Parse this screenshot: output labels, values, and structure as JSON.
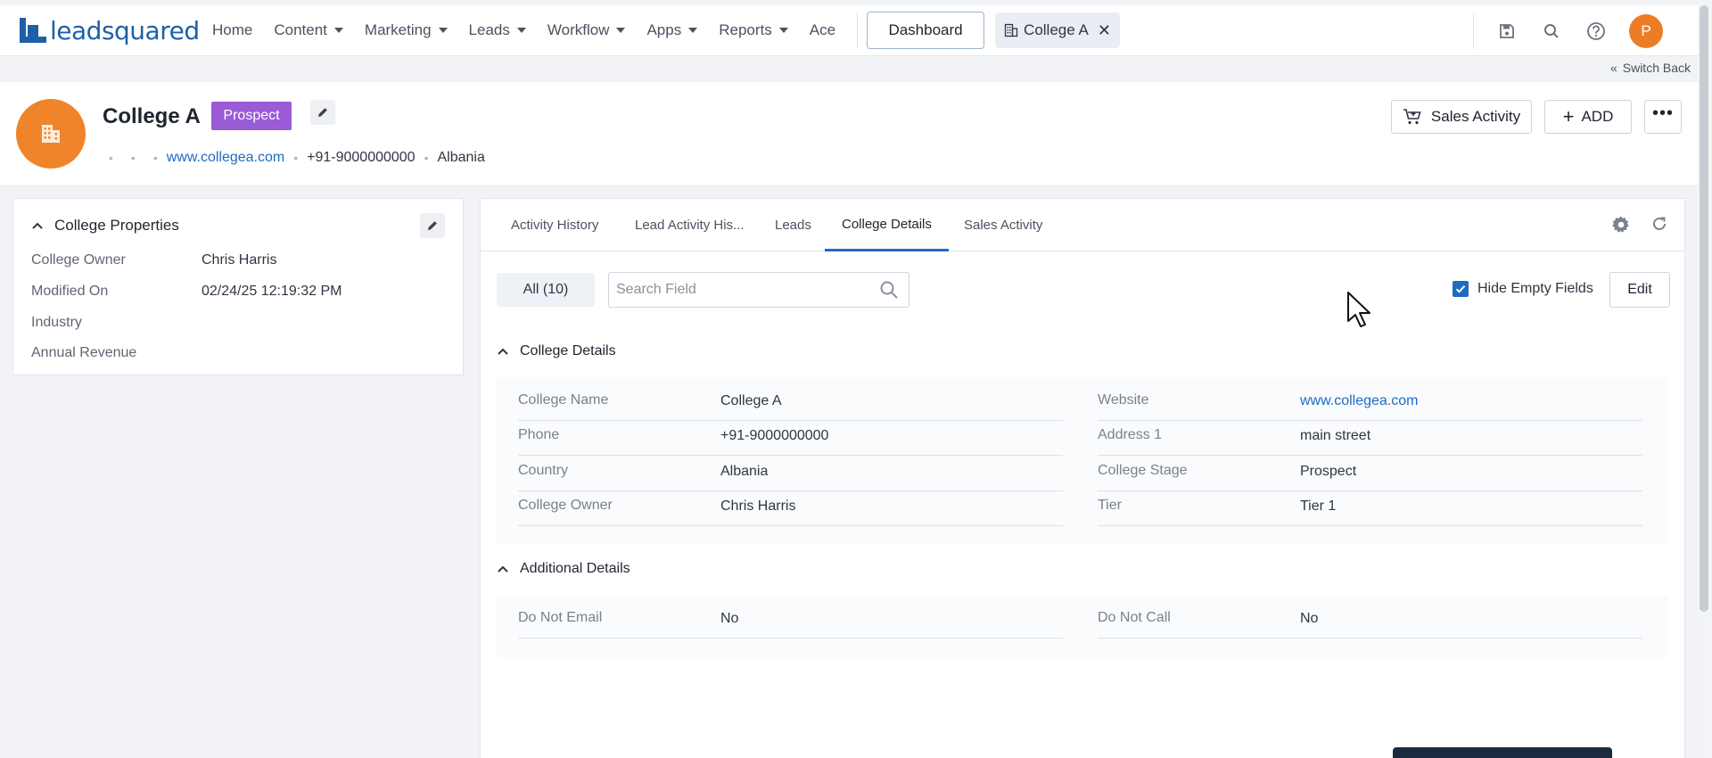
{
  "nav": {
    "logo_text": "leadsquared",
    "items": [
      {
        "label": "Home",
        "caret": false
      },
      {
        "label": "Content",
        "caret": true
      },
      {
        "label": "Marketing",
        "caret": true
      },
      {
        "label": "Leads",
        "caret": true
      },
      {
        "label": "Workflow",
        "caret": true
      },
      {
        "label": "Apps",
        "caret": true
      },
      {
        "label": "Reports",
        "caret": true
      },
      {
        "label": "Ace",
        "caret": false
      }
    ],
    "dashboard_label": "Dashboard",
    "open_tab_label": "College A",
    "avatar_initial": "P"
  },
  "switch_back": "Switch Back",
  "header": {
    "name": "College A",
    "stage_badge": "Prospect",
    "website": "www.collegea.com",
    "phone": "+91-9000000000",
    "country": "Albania",
    "sales_activity_label": "Sales Activity",
    "add_label": "ADD"
  },
  "properties": {
    "title": "College Properties",
    "rows": [
      {
        "key": "College Owner",
        "value": "Chris Harris"
      },
      {
        "key": "Modified On",
        "value": "02/24/25 12:19:32 PM"
      },
      {
        "key": "Industry",
        "value": ""
      },
      {
        "key": "Annual Revenue",
        "value": ""
      }
    ]
  },
  "tabs": [
    {
      "label": "Activity History",
      "active": false
    },
    {
      "label": "Lead Activity His...",
      "active": false
    },
    {
      "label": "Leads",
      "active": false
    },
    {
      "label": "College Details",
      "active": true
    },
    {
      "label": "Sales Activity",
      "active": false
    }
  ],
  "toolbar": {
    "all_filter": "All (10)",
    "search_placeholder": "Search Field",
    "hide_empty_label": "Hide Empty Fields",
    "hide_empty_checked": true,
    "edit_label": "Edit"
  },
  "sections": {
    "college_details": {
      "title": "College Details",
      "fields": [
        {
          "key": "College Name",
          "value": "College A"
        },
        {
          "key": "Website",
          "value": "www.collegea.com",
          "link": true
        },
        {
          "key": "Phone",
          "value": "+91-9000000000"
        },
        {
          "key": "Address 1",
          "value": "main street"
        },
        {
          "key": "Country",
          "value": "Albania"
        },
        {
          "key": "College Stage",
          "value": "Prospect"
        },
        {
          "key": "College Owner",
          "value": "Chris Harris"
        },
        {
          "key": "Tier",
          "value": "Tier 1"
        }
      ]
    },
    "additional_details": {
      "title": "Additional Details",
      "fields": [
        {
          "key": "Do Not Email",
          "value": "No"
        },
        {
          "key": "Do Not Call",
          "value": "No"
        }
      ]
    }
  },
  "colors": {
    "brand": "#1f5fa8",
    "accent": "#1e6bc2",
    "avatar": "#ec7d26",
    "badge": "#9a5bd6"
  }
}
